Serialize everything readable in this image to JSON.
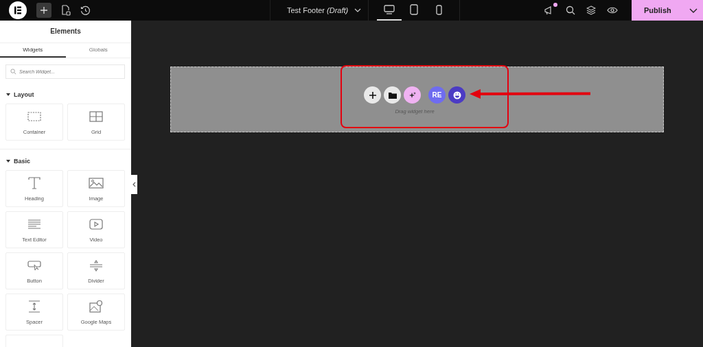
{
  "topbar": {
    "document_title": "Test Footer",
    "document_status": "(Draft)",
    "devices": [
      {
        "selected": true
      },
      {
        "selected": false
      },
      {
        "selected": false
      }
    ],
    "notification_dot": true,
    "publish": "Publish"
  },
  "sidebar": {
    "title": "Elements",
    "tabs": [
      {
        "label": "Widgets",
        "selected": true
      },
      {
        "label": "Globals",
        "selected": false
      }
    ],
    "search": {
      "placeholder": "Search Widget..."
    },
    "sections": [
      {
        "title": "Layout",
        "expanded": true,
        "widgets": [
          "Container",
          "Grid"
        ]
      },
      {
        "title": "Basic",
        "expanded": true,
        "widgets": [
          "Heading",
          "Image",
          "Text Editor",
          "Video",
          "Button",
          "Divider",
          "Spacer",
          "Google Maps"
        ]
      }
    ]
  },
  "canvas": {
    "drop_hint": "Drag widget here",
    "addon_label": "RE"
  }
}
